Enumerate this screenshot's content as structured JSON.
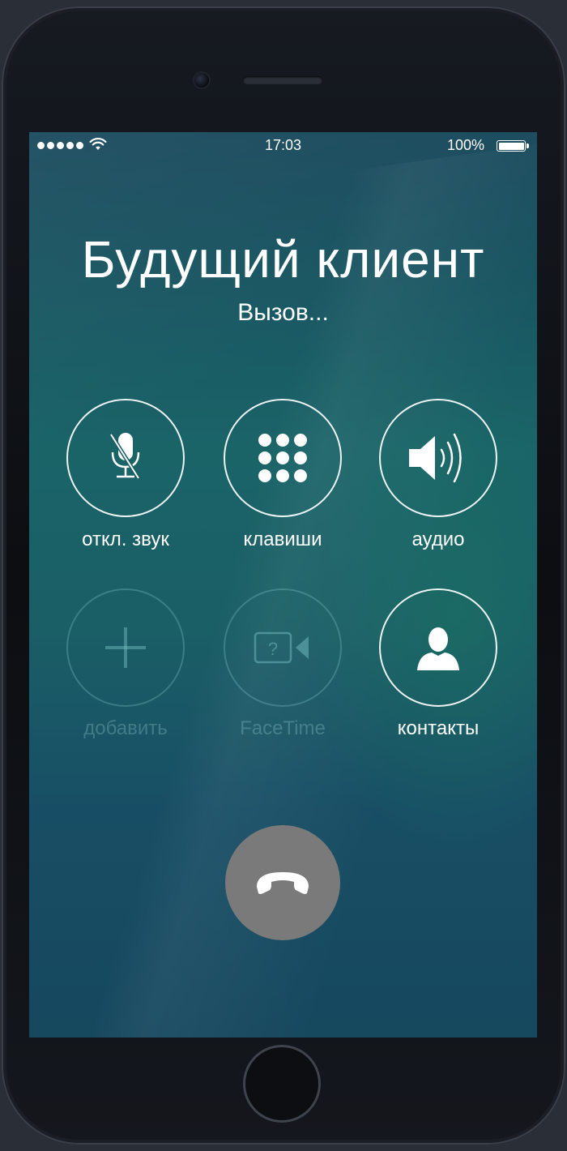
{
  "status_bar": {
    "time": "17:03",
    "battery_percent": "100%",
    "signal_bars": 5,
    "battery_level": 1.0
  },
  "call": {
    "contact_name": "Будущий клиент",
    "status": "Вызов..."
  },
  "controls": [
    {
      "label": "откл. звук",
      "icon": "mute-microphone-icon",
      "enabled": true
    },
    {
      "label": "клавиши",
      "icon": "keypad-icon",
      "enabled": true
    },
    {
      "label": "аудио",
      "icon": "speaker-icon",
      "enabled": true
    },
    {
      "label": "добавить",
      "icon": "add-call-icon",
      "enabled": false
    },
    {
      "label": "FaceTime",
      "icon": "facetime-icon",
      "enabled": false
    },
    {
      "label": "контакты",
      "icon": "contacts-icon",
      "enabled": true
    }
  ],
  "colors": {
    "end_call_button": "#7a7a7a",
    "disabled_ring": "#78bec3"
  }
}
